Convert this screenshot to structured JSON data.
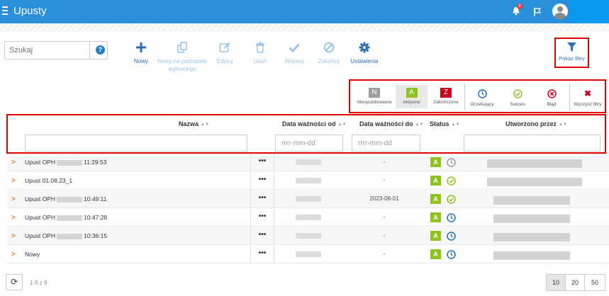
{
  "app": {
    "title": "Upusty",
    "notification_count": "8"
  },
  "search": {
    "placeholder": "Szukaj",
    "help": "?"
  },
  "toolbar": [
    {
      "label": "Nowy",
      "active": true
    },
    {
      "label": "Nowy na podstawie wybranego",
      "active": false
    },
    {
      "label": "Edytuj",
      "active": false
    },
    {
      "label": "Usuń",
      "active": false
    },
    {
      "label": "Aktywuj",
      "active": false
    },
    {
      "label": "Zakończ",
      "active": false
    },
    {
      "label": "Ustawienia",
      "active": true
    }
  ],
  "filter_button": {
    "label": "Pokaż filtry"
  },
  "status_filters": [
    {
      "letter": "N",
      "label": "Nieopublikowane",
      "color": "#9e9e9e"
    },
    {
      "letter": "A",
      "label": "Aktywne",
      "color": "#8dc21f"
    },
    {
      "letter": "Z",
      "label": "Zakończone",
      "color": "#d0021b"
    }
  ],
  "result_filters": [
    {
      "label": "Oczekujący",
      "color": "#1f6fb2"
    },
    {
      "label": "Sukces",
      "color": "#8dc21f"
    },
    {
      "label": "Błąd",
      "color": "#d0021b"
    }
  ],
  "clear_filters": {
    "label": "Wyczyść filtry",
    "icon": "✖"
  },
  "columns": {
    "name": "Nazwa",
    "valid_from": "Data ważności od",
    "valid_to": "Data ważności do",
    "status": "Status",
    "created_by": "Utworzono przez"
  },
  "filters": {
    "date_placeholder": "rrrr-mm-dd"
  },
  "rows": [
    {
      "name_prefix": "Upust OPH",
      "name_suffix": "11:29:53",
      "redacted": true,
      "valid_to": "-",
      "status": "A",
      "result": "pending-grey"
    },
    {
      "name_prefix": "Upust 01.08.23_1",
      "name_suffix": "",
      "redacted": false,
      "valid_to": "-",
      "status": "A",
      "result": "success"
    },
    {
      "name_prefix": "Upust OPH",
      "name_suffix": "10:49:11",
      "redacted": true,
      "valid_to": "2023-08-01",
      "status": "A",
      "result": "success"
    },
    {
      "name_prefix": "Upust OPH",
      "name_suffix": "10:47:28",
      "redacted": true,
      "valid_to": "-",
      "status": "A",
      "result": "pending"
    },
    {
      "name_prefix": "Upust OPH",
      "name_suffix": "10:36:15",
      "redacted": true,
      "valid_to": "-",
      "status": "A",
      "result": "pending"
    },
    {
      "name_prefix": "Nowy",
      "name_suffix": "",
      "redacted": false,
      "valid_to": "-",
      "status": "A",
      "result": "pending"
    }
  ],
  "pagination": {
    "info": "1-9 z 9",
    "sizes": [
      "10",
      "20",
      "50"
    ],
    "selected": "10"
  }
}
